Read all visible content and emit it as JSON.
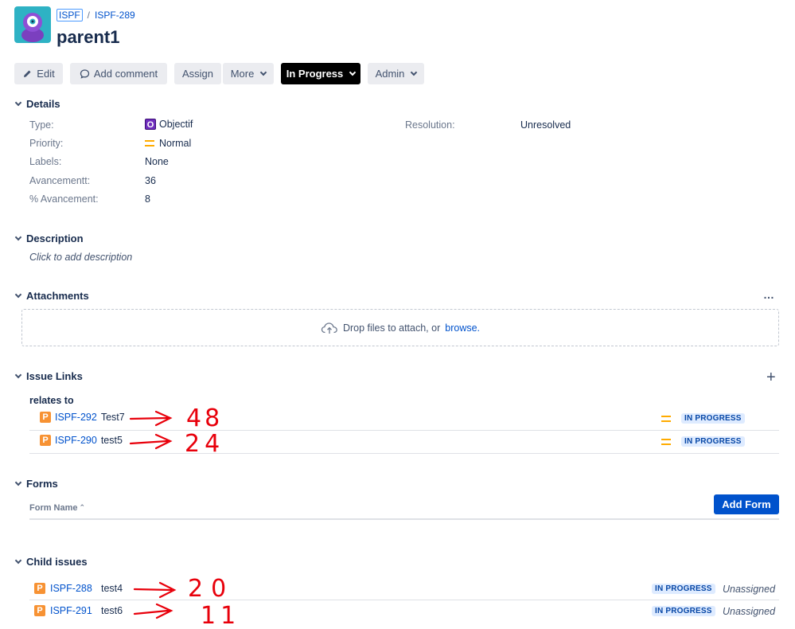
{
  "header": {
    "project_key": "ISPF",
    "separator": "/",
    "issue_key": "ISPF-289",
    "title": "parent1"
  },
  "toolbar": {
    "edit": "Edit",
    "add_comment": "Add comment",
    "assign": "Assign",
    "more": "More",
    "status": "In Progress",
    "admin": "Admin"
  },
  "details": {
    "heading": "Details",
    "type_label": "Type:",
    "type_value": "Objectif",
    "type_icon_glyph": "O",
    "priority_label": "Priority:",
    "priority_value": "Normal",
    "labels_label": "Labels:",
    "labels_value": "None",
    "avancementt_label": "Avancementt:",
    "avancementt_value": "36",
    "pct_label": "% Avancement:",
    "pct_value": "8",
    "resolution_label": "Resolution:",
    "resolution_value": "Unresolved"
  },
  "description": {
    "heading": "Description",
    "placeholder": "Click to add description"
  },
  "attachments": {
    "heading": "Attachments",
    "menu": "…",
    "drop_text": "Drop files to attach, or",
    "browse": "browse."
  },
  "issue_links": {
    "heading": "Issue Links",
    "add": "+",
    "relation": "relates to",
    "links": [
      {
        "key": "ISPF-292",
        "summary": "Test7",
        "status": "IN PROGRESS",
        "annotation": "48"
      },
      {
        "key": "ISPF-290",
        "summary": "test5",
        "status": "IN PROGRESS",
        "annotation": "24"
      }
    ]
  },
  "forms": {
    "heading": "Forms",
    "column": "Form Name",
    "sort_glyph": "⌃",
    "add_button": "Add Form"
  },
  "child_issues": {
    "heading": "Child issues",
    "items": [
      {
        "key": "ISPF-288",
        "summary": "test4",
        "status": "IN PROGRESS",
        "assignee": "Unassigned",
        "annotation": "20"
      },
      {
        "key": "ISPF-291",
        "summary": "test6",
        "status": "IN PROGRESS",
        "assignee": "Unassigned",
        "annotation": "11"
      }
    ]
  },
  "icons": {
    "story_glyph": "P",
    "annotation_color": "#e8000b"
  }
}
